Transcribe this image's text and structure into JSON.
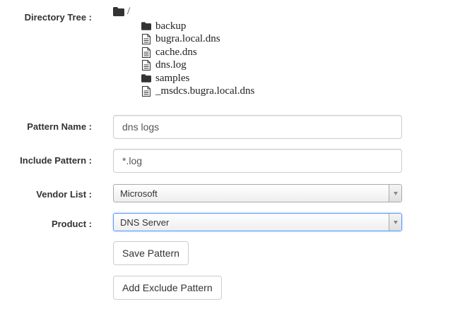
{
  "directory_tree": {
    "label": "Directory Tree :",
    "root": "/",
    "items": [
      {
        "name": "backup",
        "type": "folder"
      },
      {
        "name": "bugra.local.dns",
        "type": "file"
      },
      {
        "name": "cache.dns",
        "type": "file"
      },
      {
        "name": "dns.log",
        "type": "file"
      },
      {
        "name": "samples",
        "type": "folder"
      },
      {
        "name": "_msdcs.bugra.local.dns",
        "type": "file"
      }
    ]
  },
  "pattern_name": {
    "label": "Pattern Name :",
    "value": "dns logs"
  },
  "include_pattern": {
    "label": "Include Pattern :",
    "value": "*.log"
  },
  "vendor_list": {
    "label": "Vendor List :",
    "selected": "Microsoft"
  },
  "product": {
    "label": "Product :",
    "selected": "DNS Server"
  },
  "buttons": {
    "save": "Save Pattern",
    "add_exclude": "Add Exclude Pattern"
  }
}
